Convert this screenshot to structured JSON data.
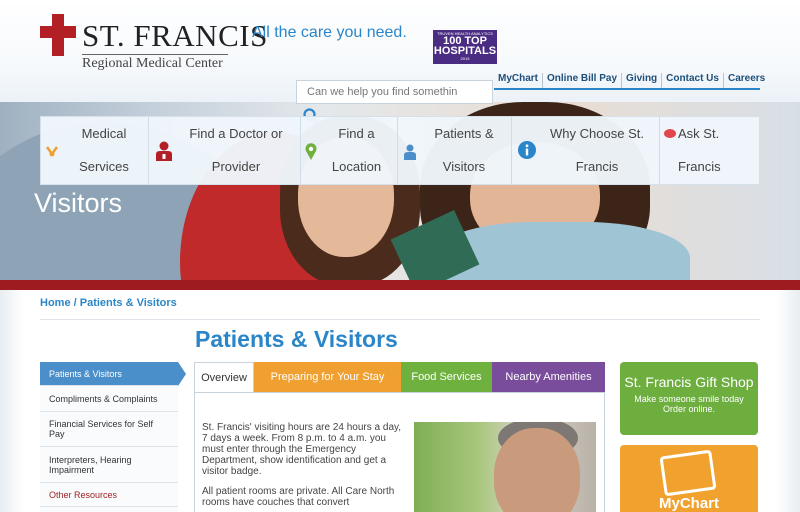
{
  "header": {
    "logo_name": "ST. FRANCIS",
    "logo_sub": "Regional Medical Center",
    "tagline": "All the care you need.",
    "award": {
      "top": "TRUVEN HEALTH ANALYTICS",
      "main": "100 TOP HOSPITALS",
      "year": "2015"
    },
    "search_placeholder": "Can we help you find somethin",
    "util_nav": [
      "MyChart",
      "Online Bill Pay",
      "Giving",
      "Contact Us",
      "Careers"
    ]
  },
  "main_nav": [
    {
      "label": "Medical\nServices",
      "icon": "medical-services-icon"
    },
    {
      "label": "Find a Doctor or\nProvider",
      "icon": "doctor-icon"
    },
    {
      "label": "Find a\nLocation",
      "icon": "location-pin-icon"
    },
    {
      "label": "Patients &\nVisitors",
      "icon": "person-icon"
    },
    {
      "label": "Why Choose St.\nFrancis",
      "icon": "info-icon"
    },
    {
      "label": "Ask St. Francis",
      "icon": "chat-bubble-icon"
    }
  ],
  "hero": {
    "title": "Visitors"
  },
  "breadcrumb": {
    "home": "Home",
    "separator": "/",
    "current": "Patients & Visitors"
  },
  "page_title": "Patients & Visitors",
  "side_nav": [
    "Patients & Visitors",
    "Compliments & Complaints",
    "Financial Services for Self Pay",
    "Interpreters, Hearing Impairment",
    "Other Resources"
  ],
  "tabs": [
    "Overview",
    "Preparing for Your Stay",
    "Food Services",
    "Nearby Amenities"
  ],
  "overview": {
    "p1": "St. Francis' visiting hours are 24 hours a day, 7 days a week. From 8 p.m. to 4 a.m. you must enter through the Emergency Department, show identification and get a visitor badge.",
    "p2": "All patient rooms are private. All Care North rooms have couches that convert"
  },
  "promos": {
    "gift_title": "St. Francis Gift Shop",
    "gift_line1": "Make someone smile today",
    "gift_line2": "Order online.",
    "mychart_label": "MyChart"
  },
  "colors": {
    "brand_blue": "#2a86c8",
    "brand_red": "#9e1c1f",
    "tab_orange": "#f0a030",
    "tab_green": "#6fb13f",
    "tab_purple": "#7a4d9c"
  }
}
